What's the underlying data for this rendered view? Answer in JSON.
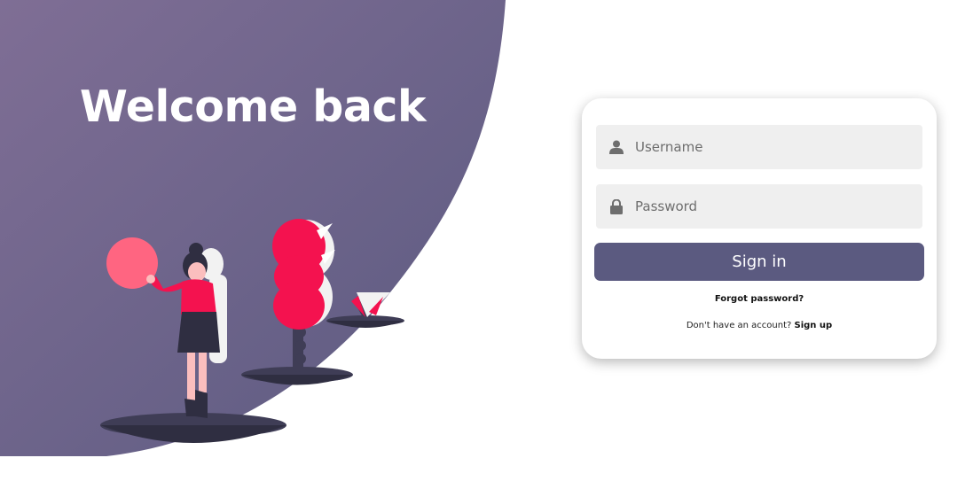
{
  "hero": {
    "title": "Welcome back",
    "gradient_start": "#7f6e95",
    "gradient_end": "#5b5a80"
  },
  "login": {
    "username_placeholder": "Username",
    "username_icon": "user-icon",
    "password_placeholder": "Password",
    "password_icon": "lock-icon",
    "signin_label": "Sign in",
    "forgot_label": "Forgot password?",
    "signup_prompt": "Don't have an account?",
    "signup_label": "Sign up",
    "button_color": "#5b5a80",
    "field_color": "#efefef"
  },
  "illustration": {
    "accent_color": "#f4124f",
    "ball_color": "#ff6581",
    "platform_color": "#3f3d56"
  }
}
